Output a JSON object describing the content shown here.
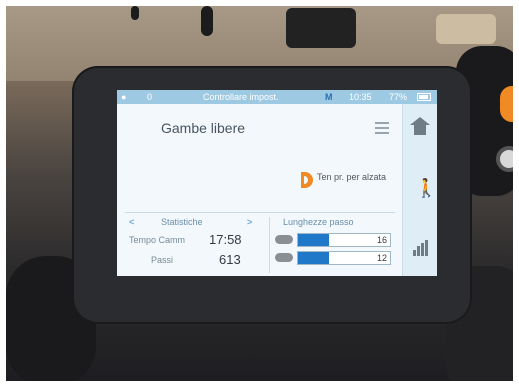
{
  "status_bar": {
    "count": "0",
    "message": "Controllare impost.",
    "mode": "M",
    "time": "10:35",
    "battery": "77%"
  },
  "screen": {
    "title": "Gambe libere",
    "hint": "Ten pr. per alzata"
  },
  "statistics": {
    "header": "Statistiche",
    "prev_arrow": "<",
    "next_arrow": ">",
    "rows": [
      {
        "label": "Tempo Camm",
        "value": "17:58"
      },
      {
        "label": "Passi",
        "value": "613"
      }
    ]
  },
  "step_lengths": {
    "header": "Lunghezze passo",
    "items": [
      {
        "value": "16",
        "fill_percent": 34
      },
      {
        "value": "12",
        "fill_percent": 34
      }
    ]
  },
  "sidebar": {
    "icons": [
      "home-icon",
      "walker-icon",
      "chart-icon"
    ]
  },
  "colors": {
    "accent": "#1f78c8",
    "status_bar": "#9dc9e3",
    "hint_logo": "#f08a24"
  }
}
